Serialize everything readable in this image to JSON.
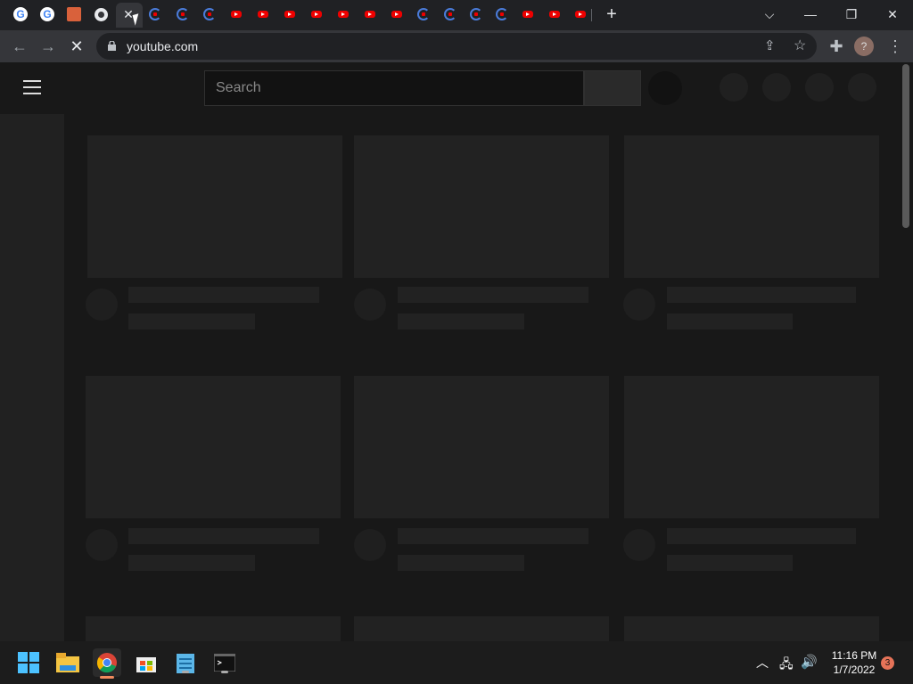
{
  "browser": {
    "tabs_icons": [
      "google",
      "google",
      "app",
      "chrome",
      "close",
      "yt-spin",
      "yt-spin",
      "yt-spin",
      "yt",
      "yt",
      "yt",
      "yt",
      "yt",
      "yt",
      "yt",
      "yt-spin",
      "yt-spin",
      "yt-spin",
      "yt-spin",
      "yt",
      "yt",
      "yt"
    ],
    "new_tab_label": "+",
    "url": "youtube.com"
  },
  "youtube": {
    "search_placeholder": "Search"
  },
  "taskbar": {
    "time": "11:16 PM",
    "date": "1/7/2022",
    "notification_count": "3"
  },
  "colors": {
    "youtube_red": "#e00000",
    "chrome_bg": "#202124",
    "toolbar_bg": "#35363a",
    "page_bg": "#181818"
  }
}
